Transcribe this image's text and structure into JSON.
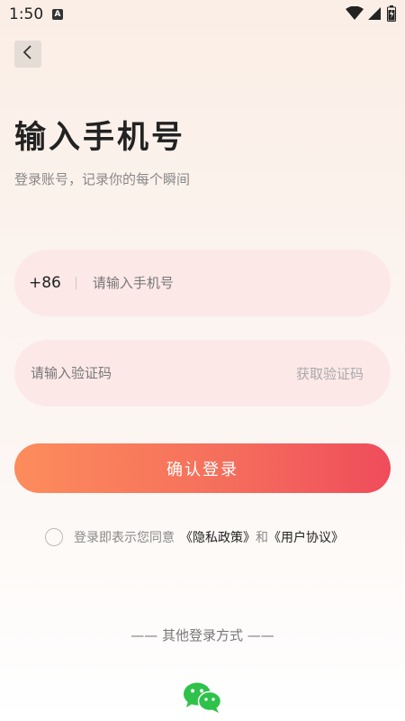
{
  "status_bar": {
    "time": "1:50",
    "badge": "A"
  },
  "header": {
    "back_icon": "chevron-left-icon"
  },
  "title": "输入手机号",
  "subtitle": "登录账号，记录你的每个瞬间",
  "phone_field": {
    "country_code": "+86",
    "placeholder": "请输入手机号",
    "value": ""
  },
  "code_field": {
    "placeholder": "请输入验证码",
    "value": "",
    "get_code_label": "获取验证码"
  },
  "login_button": {
    "label": "确认登录"
  },
  "agreement": {
    "prefix": "登录即表示您同意",
    "privacy_link": "《隐私政策》",
    "and": "和",
    "terms_link": "《用户协议》",
    "checked": false
  },
  "other_login": {
    "label": "—— 其他登录方式 ——",
    "providers": [
      "wechat-icon"
    ]
  },
  "colors": {
    "accent_start": "#fd8c5c",
    "accent_end": "#ef4c5b",
    "field_bg": "#fde8e8",
    "wechat_green": "#2ec24a"
  }
}
